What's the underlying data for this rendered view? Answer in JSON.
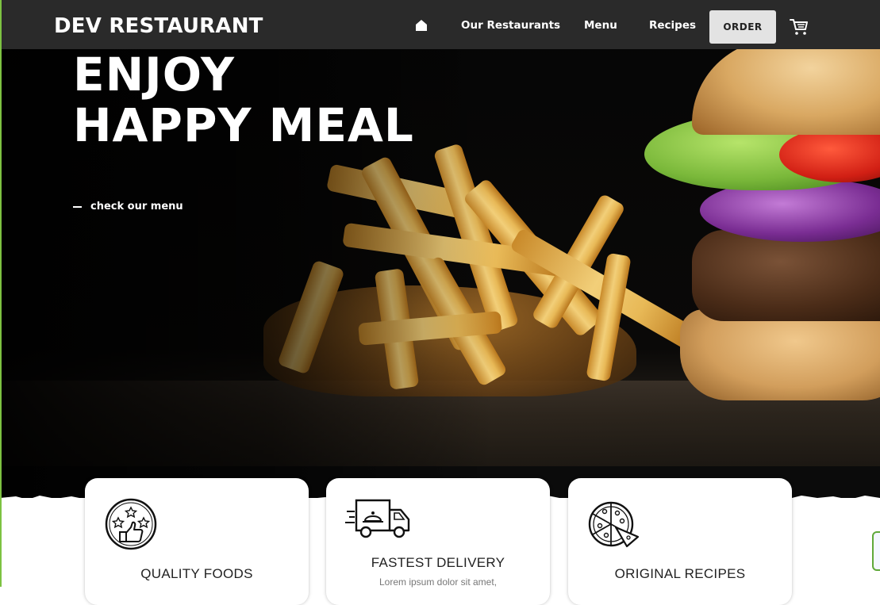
{
  "header": {
    "brand": "DEV RESTAURANT",
    "nav": {
      "home_icon": "home-icon",
      "links": [
        "Our Restaurants",
        "Menu",
        "Recipes"
      ],
      "order_label": "ORDER",
      "cart_icon": "cart-icon"
    }
  },
  "hero": {
    "title_line1": "ENJOY",
    "title_line2": "HAPPY MEAL",
    "cta": "check our menu"
  },
  "features": [
    {
      "title": "QUALITY FOODS",
      "icon": "thumbs-up-stars-icon"
    },
    {
      "title": "FASTEST DELIVERY",
      "desc": "Lorem ipsum dolor sit amet,",
      "icon": "delivery-truck-icon"
    },
    {
      "title": "ORIGINAL RECIPES",
      "icon": "pizza-icon"
    }
  ],
  "colors": {
    "nav_bg": "#2a2a2a",
    "hero_bg": "#050505",
    "accent_green": "#7dc242",
    "order_button_bg": "#e3e3e3"
  }
}
